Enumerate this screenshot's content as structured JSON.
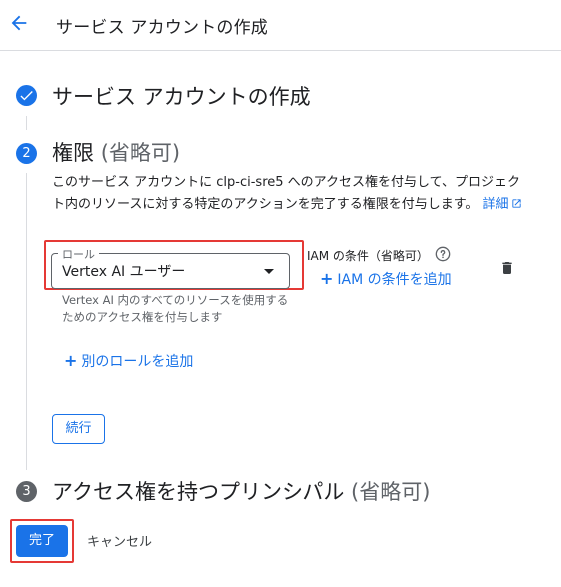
{
  "header": {
    "title": "サービス アカウントの作成"
  },
  "steps": {
    "step1": {
      "title": "サービス アカウントの作成"
    },
    "step2": {
      "number": "2",
      "title": "権限",
      "optional": "(省略可)",
      "description": "このサービス アカウントに clp-ci-sre5 へのアクセス権を付与して、プロジェクト内のリソースに対する特定のアクションを完了する権限を付与します。",
      "details_link": "詳細"
    },
    "step3": {
      "number": "3",
      "title": "アクセス権を持つプリンシパル",
      "optional": "(省略可)"
    }
  },
  "role": {
    "legend": "ロール",
    "selected": "Vertex AI ユーザー",
    "help": "Vertex AI 内のすべてのリソースを使用するためのアクセス権を付与します"
  },
  "iam_condition": {
    "label": "IAM の条件（省略可）",
    "add_label": "IAM の条件を追加"
  },
  "add_role_label": "別のロールを追加",
  "buttons": {
    "continue": "続行",
    "done": "完了",
    "cancel": "キャンセル"
  },
  "icons": {
    "back": "arrow-back-icon",
    "check": "check-icon",
    "help": "help-icon",
    "delete": "trash-icon",
    "external": "external-link-icon",
    "add": "plus-icon"
  },
  "colors": {
    "accent": "#1a73e8",
    "highlight": "#e53935",
    "inactive_step": "#5f6368"
  }
}
